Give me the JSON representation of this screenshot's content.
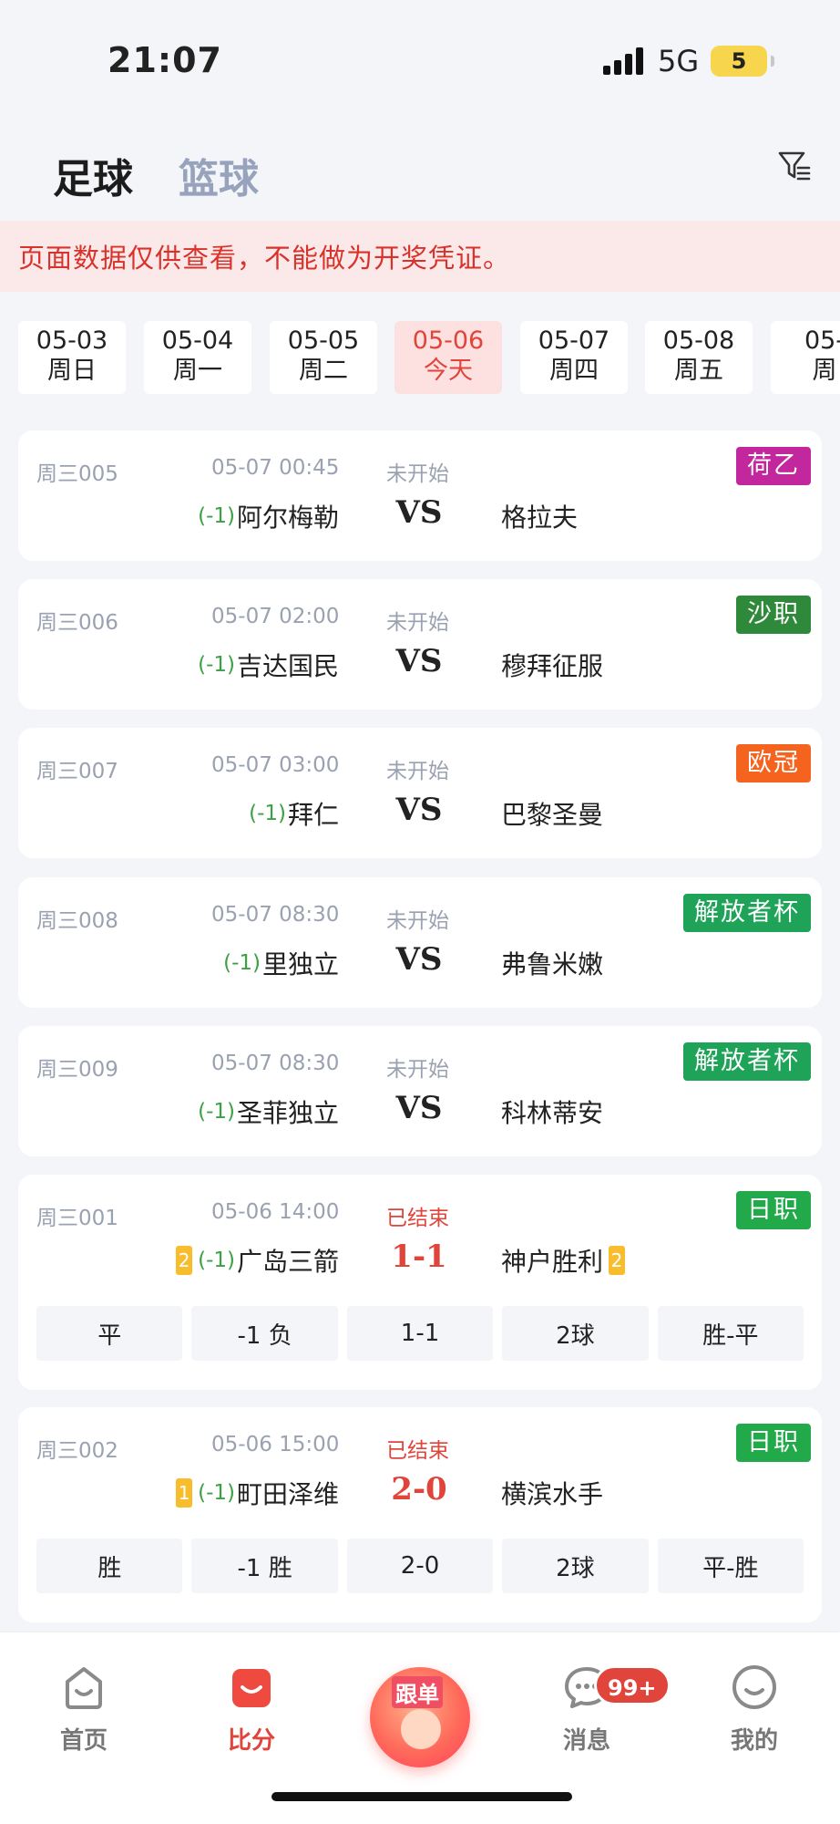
{
  "status_bar": {
    "time": "21:07",
    "network": "5G",
    "battery": "5"
  },
  "header": {
    "tabs": [
      {
        "label": "足球",
        "active": true
      },
      {
        "label": "篮球",
        "active": false
      }
    ],
    "filter_icon": "filter-icon"
  },
  "notice": "页面数据仅供查看，不能做为开奖凭证。",
  "dates": [
    {
      "date": "05-03",
      "weekday": "周日"
    },
    {
      "date": "05-04",
      "weekday": "周一"
    },
    {
      "date": "05-05",
      "weekday": "周二"
    },
    {
      "date": "05-06",
      "weekday": "今天",
      "active": true
    },
    {
      "date": "05-07",
      "weekday": "周四"
    },
    {
      "date": "05-08",
      "weekday": "周五"
    },
    {
      "date": "05-",
      "weekday": "周"
    }
  ],
  "matches": [
    {
      "code": "周三005",
      "time": "05-07 00:45",
      "status": "未开始",
      "league": "荷乙",
      "league_color": "#c2279e",
      "handicap": "(-1)",
      "home": "阿尔梅勒",
      "center": "VS",
      "away": "格拉夫"
    },
    {
      "code": "周三006",
      "time": "05-07 02:00",
      "status": "未开始",
      "league": "沙职",
      "league_color": "#2e8a3a",
      "handicap": "(-1)",
      "home": "吉达国民",
      "center": "VS",
      "away": "穆拜征服"
    },
    {
      "code": "周三007",
      "time": "05-07 03:00",
      "status": "未开始",
      "league": "欧冠",
      "league_color": "#f4641f",
      "handicap": "(-1)",
      "home": "拜仁",
      "center": "VS",
      "away": "巴黎圣曼"
    },
    {
      "code": "周三008",
      "time": "05-07 08:30",
      "status": "未开始",
      "league": "解放者杯",
      "league_color": "#1ea358",
      "handicap": "(-1)",
      "home": "里独立",
      "center": "VS",
      "away": "弗鲁米嫩"
    },
    {
      "code": "周三009",
      "time": "05-07 08:30",
      "status": "未开始",
      "league": "解放者杯",
      "league_color": "#1ea358",
      "handicap": "(-1)",
      "home": "圣菲独立",
      "center": "VS",
      "away": "科林蒂安"
    },
    {
      "code": "周三001",
      "time": "05-06 14:00",
      "status": "已结束",
      "league": "日职",
      "league_color": "#21a94a",
      "home_rank": "2",
      "handicap": "(-1)",
      "home": "广岛三箭",
      "center": "1-1",
      "away": "神户胜利",
      "away_rank": "2",
      "results": [
        "平",
        "-1 负",
        "1-1",
        "2球",
        "胜-平"
      ]
    },
    {
      "code": "周三002",
      "time": "05-06 15:00",
      "status": "已结束",
      "league": "日职",
      "league_color": "#21a94a",
      "home_rank": "1",
      "handicap": "(-1)",
      "home": "町田泽维",
      "center": "2-0",
      "away": "横滨水手",
      "results": [
        "胜",
        "-1 胜",
        "2-0",
        "2球",
        "平-胜"
      ]
    }
  ],
  "bottom_nav": {
    "items": [
      {
        "label": "首页",
        "icon": "home-icon"
      },
      {
        "label": "比分",
        "icon": "score-icon",
        "active": true
      },
      {
        "label": "跟单",
        "icon": "follow-mascot-icon"
      },
      {
        "label": "消息",
        "icon": "message-icon",
        "badge": "99+"
      },
      {
        "label": "我的",
        "icon": "profile-icon"
      }
    ]
  }
}
